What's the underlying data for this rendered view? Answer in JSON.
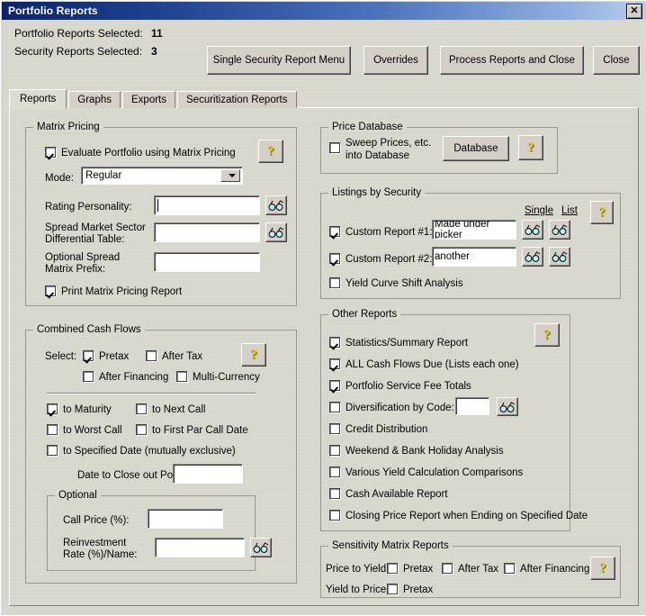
{
  "window": {
    "title": "Portfolio Reports",
    "close_icon": "close-icon",
    "close_label": "✕"
  },
  "header": {
    "portfolio_label": "Portfolio Reports Selected:",
    "portfolio_count": "11",
    "security_label": "Security Reports Selected:",
    "security_count": "3",
    "buttons": {
      "single_security": "Single Security Report Menu",
      "overrides": "Overrides",
      "process": "Process Reports and Close",
      "close": "Close"
    }
  },
  "tabs": [
    {
      "label": "Reports",
      "active": true
    },
    {
      "label": "Graphs",
      "active": false
    },
    {
      "label": "Exports",
      "active": false
    },
    {
      "label": "Securitization Reports",
      "active": false
    }
  ],
  "matrix_pricing": {
    "title": "Matrix Pricing",
    "evaluate_label": "Evaluate Portfolio using Matrix Pricing",
    "evaluate_checked": true,
    "mode_label": "Mode:",
    "mode_value": "Regular",
    "rating_label": "Rating Personality:",
    "rating_value": "",
    "spread_label_1": "Spread Market Sector",
    "spread_label_2": "Differential Table:",
    "spread_value": "",
    "prefix_label_1": "Optional Spread",
    "prefix_label_2": "Matrix Prefix:",
    "prefix_value": "",
    "print_label": "Print Matrix Pricing Report",
    "print_checked": true,
    "help_icon": "help-icon",
    "help_glyph": "?",
    "binoculars_icon": "binoculars-icon"
  },
  "combined_cash_flows": {
    "title": "Combined Cash Flows",
    "select_label": "Select:",
    "pretax_label": "Pretax",
    "pretax_checked": true,
    "after_tax_label": "After Tax",
    "after_tax_checked": false,
    "after_financing_label": "After Financing",
    "after_financing_checked": false,
    "multi_currency_label": "Multi-Currency",
    "multi_currency_checked": false,
    "to_maturity_label": "to Maturity",
    "to_maturity_checked": true,
    "to_next_call_label": "to Next Call",
    "to_next_call_checked": false,
    "to_worst_call_label": "to Worst Call",
    "to_worst_call_checked": false,
    "to_first_par_label": "to First Par Call Date",
    "to_first_par_checked": false,
    "to_specified_label": "to Specified Date (mutually exclusive)",
    "to_specified_checked": false,
    "date_close_label": "Date to Close out Portfolio:",
    "date_close_value": "",
    "optional": {
      "title": "Optional",
      "call_price_label": "Call Price (%):",
      "call_price_value": "",
      "reinvest_label_1": "Reinvestment",
      "reinvest_label_2": "Rate (%)/Name:",
      "reinvest_value": ""
    },
    "help_glyph": "?"
  },
  "price_database": {
    "title": "Price Database",
    "sweep_label_1": "Sweep Prices, etc.",
    "sweep_label_2": "into Database",
    "sweep_checked": false,
    "database_button": "Database",
    "help_glyph": "?"
  },
  "listings_by_security": {
    "title": "Listings by Security",
    "single_header": "Single",
    "list_header": "List",
    "report1_label": "Custom Report #1:",
    "report1_checked": true,
    "report1_value": "Made under picker",
    "report2_label": "Custom Report #2:",
    "report2_checked": true,
    "report2_value": "another",
    "yield_curve_label": "Yield Curve Shift Analysis",
    "yield_curve_checked": false,
    "help_glyph": "?"
  },
  "other_reports": {
    "title": "Other Reports",
    "help_glyph": "?",
    "items": [
      {
        "label": "Statistics/Summary Report",
        "checked": true
      },
      {
        "label": "ALL Cash Flows Due (Lists each one)",
        "checked": true
      },
      {
        "label": "Portfolio Service Fee Totals",
        "checked": true
      },
      {
        "label": "Diversification by Code:",
        "checked": false
      },
      {
        "label": "Credit Distribution",
        "checked": false
      },
      {
        "label": "Weekend & Bank Holiday Analysis",
        "checked": false
      },
      {
        "label": "Various Yield Calculation Comparisons",
        "checked": false
      },
      {
        "label": "Cash Available Report",
        "checked": false
      },
      {
        "label": "Closing Price Report when Ending on Specified Date",
        "checked": false
      }
    ],
    "diversification_value": ""
  },
  "sensitivity_matrix": {
    "title": "Sensitivity Matrix Reports",
    "price_to_yield_label": "Price to Yield:",
    "yield_to_price_label": "Yield to Price:",
    "pretax_label": "Pretax",
    "after_tax_label": "After Tax",
    "after_financing_label": "After Financing",
    "pty_pretax_checked": false,
    "pty_after_tax_checked": false,
    "pty_after_financing_checked": false,
    "ytp_pretax_checked": false,
    "help_glyph": "?"
  }
}
